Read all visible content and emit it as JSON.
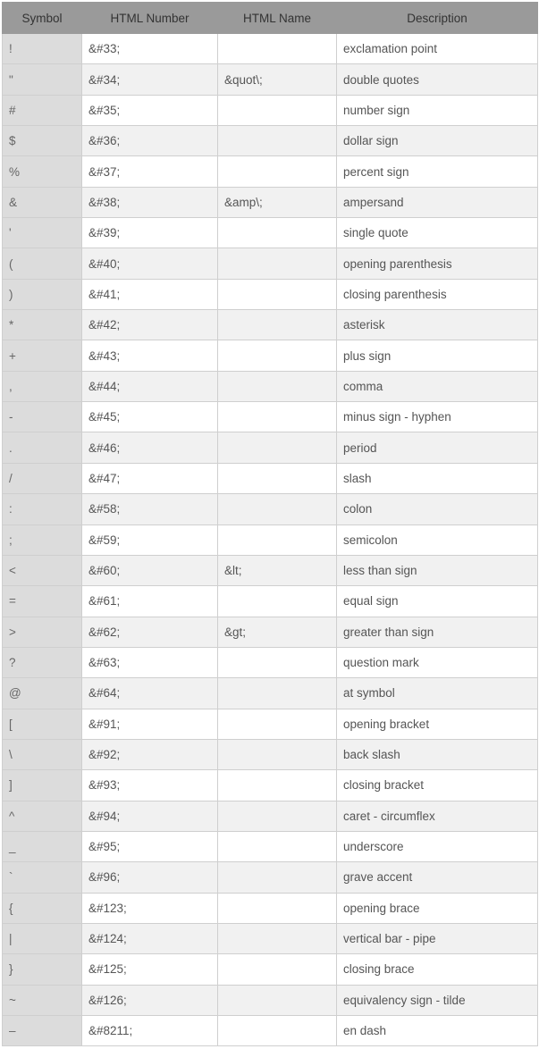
{
  "headers": [
    "Symbol",
    "HTML Number",
    "HTML Name",
    "Description"
  ],
  "rows": [
    [
      "!",
      "&#33;",
      "",
      "exclamation point"
    ],
    [
      "\"",
      "&#34;",
      "&quot\\;",
      "double quotes"
    ],
    [
      "#",
      "&#35;",
      "",
      "number sign"
    ],
    [
      "$",
      "&#36;",
      "",
      "dollar sign"
    ],
    [
      "%",
      "&#37;",
      "",
      "percent sign"
    ],
    [
      "&",
      "&#38;",
      "&amp\\;",
      "ampersand"
    ],
    [
      "'",
      "&#39;",
      "",
      "single quote"
    ],
    [
      "(",
      "&#40;",
      "",
      "opening parenthesis"
    ],
    [
      ")",
      "&#41;",
      "",
      "closing parenthesis"
    ],
    [
      "*",
      "&#42;",
      "",
      "asterisk"
    ],
    [
      "+",
      "&#43;",
      "",
      "plus sign"
    ],
    [
      ",",
      "&#44;",
      "",
      "comma"
    ],
    [
      "-",
      "&#45;",
      "",
      "minus sign - hyphen"
    ],
    [
      ".",
      "&#46;",
      "",
      "period"
    ],
    [
      "/",
      "&#47;",
      "",
      "slash"
    ],
    [
      ":",
      "&#58;",
      "",
      "colon"
    ],
    [
      ";",
      "&#59;",
      "",
      "semicolon"
    ],
    [
      "<",
      "&#60;",
      "&lt;",
      "less than sign"
    ],
    [
      "=",
      "&#61;",
      "",
      "equal sign"
    ],
    [
      ">",
      "&#62;",
      "&gt;",
      "greater than sign"
    ],
    [
      "?",
      "&#63;",
      "",
      "question mark"
    ],
    [
      "@",
      "&#64;",
      "",
      "at symbol"
    ],
    [
      "[",
      "&#91;",
      "",
      "opening bracket"
    ],
    [
      "\\",
      "&#92;",
      "",
      "back slash"
    ],
    [
      "]",
      "&#93;",
      "",
      "closing bracket"
    ],
    [
      "^",
      "&#94;",
      "",
      "caret - circumflex"
    ],
    [
      "_",
      "&#95;",
      "",
      "underscore"
    ],
    [
      "`",
      "&#96;",
      "",
      "grave accent"
    ],
    [
      "{",
      "&#123;",
      "",
      "opening brace"
    ],
    [
      "|",
      "&#124;",
      "",
      "vertical bar - pipe"
    ],
    [
      "}",
      "&#125;",
      "",
      "closing brace"
    ],
    [
      "~",
      "&#126;",
      "",
      "equivalency sign - tilde"
    ],
    [
      "–",
      "&#8211;",
      "",
      "en dash"
    ]
  ]
}
